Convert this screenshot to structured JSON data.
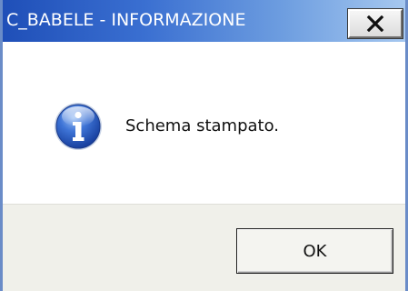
{
  "window": {
    "title": "C_BABELE - INFORMAZIONE"
  },
  "dialog": {
    "icon": "information-icon",
    "message": "Schema stampato.",
    "ok_label": "OK"
  },
  "colors": {
    "titlebar_start": "#1f4fb8",
    "titlebar_end": "#a6c8f0",
    "footer_bg": "#f0f0ea",
    "icon_blue": "#2f62c7"
  }
}
